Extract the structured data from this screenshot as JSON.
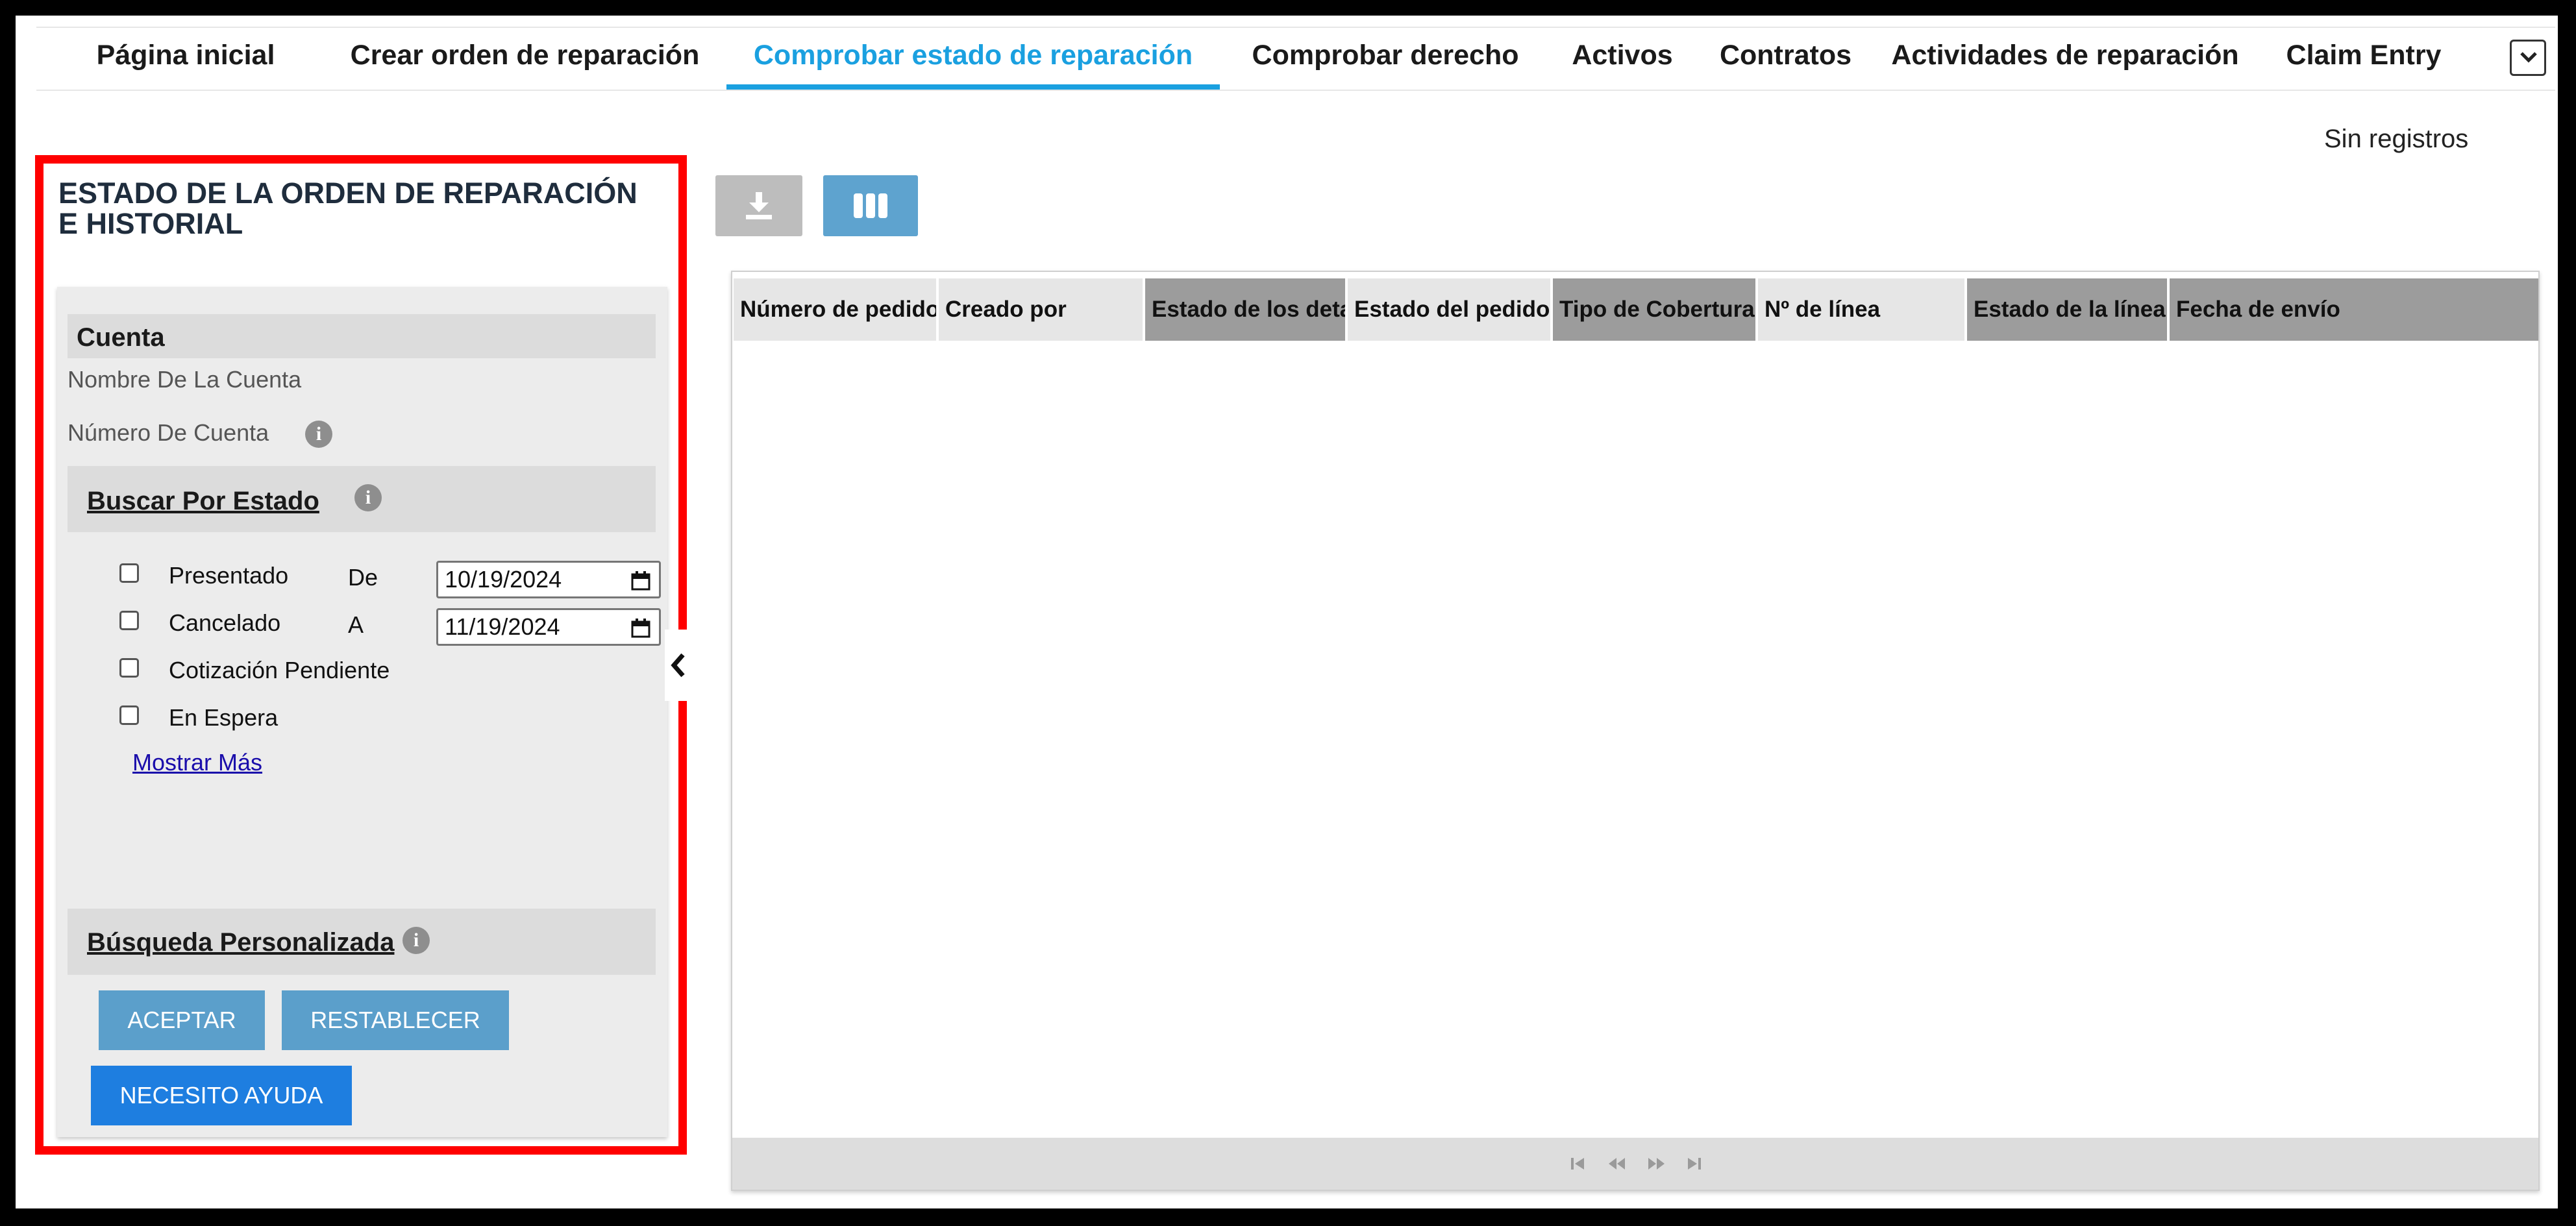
{
  "nav": {
    "tabs": [
      {
        "label": "Página inicial"
      },
      {
        "label": "Crear orden de reparación"
      },
      {
        "label": "Comprobar estado de reparación",
        "active": true
      },
      {
        "label": "Comprobar derecho"
      },
      {
        "label": "Activos"
      },
      {
        "label": "Contratos"
      },
      {
        "label": "Actividades de reparación"
      },
      {
        "label": "Claim Entry"
      }
    ],
    "more_icon": "chevron-down-icon"
  },
  "records_text": "Sin registros",
  "panel": {
    "title": "ESTADO DE LA ORDEN DE REPARACIÓN E HISTORIAL",
    "account": {
      "header": "Cuenta",
      "name_label": "Nombre De La Cuenta",
      "number_label": "Número De Cuenta"
    },
    "status_search": {
      "header": "Buscar Por Estado",
      "statuses": [
        {
          "label": "Presentado",
          "checked": false
        },
        {
          "label": "Cancelado",
          "checked": false
        },
        {
          "label": "Cotización Pendiente",
          "checked": false
        },
        {
          "label": "En Espera",
          "checked": false
        }
      ],
      "from_label": "De",
      "from_value": "10/19/2024",
      "to_label": "A",
      "to_value": "11/19/2024",
      "show_more": "Mostrar Más"
    },
    "custom_search": {
      "header": "Búsqueda Personalizada"
    },
    "buttons": {
      "accept": "ACEPTAR",
      "reset": "RESTABLECER",
      "help": "NECESITO AYUDA"
    }
  },
  "toolbar": {
    "download_icon": "download-icon",
    "columns_icon": "columns-icon"
  },
  "grid": {
    "columns": [
      {
        "label": "Número de pedido",
        "sorted": true
      },
      {
        "label": "Creado por"
      },
      {
        "label": "Estado de los detal"
      },
      {
        "label": "Estado del pedido"
      },
      {
        "label": "Tipo de Cobertura"
      },
      {
        "label": "Nº de línea"
      },
      {
        "label": "Estado de la línea"
      },
      {
        "label": "Fecha de envío"
      }
    ],
    "rows": []
  },
  "colors": {
    "accent": "#1aa0e0",
    "highlight_border": "#ff0000",
    "button_muted": "#5b9fcb",
    "button_primary": "#1e7ee0"
  }
}
